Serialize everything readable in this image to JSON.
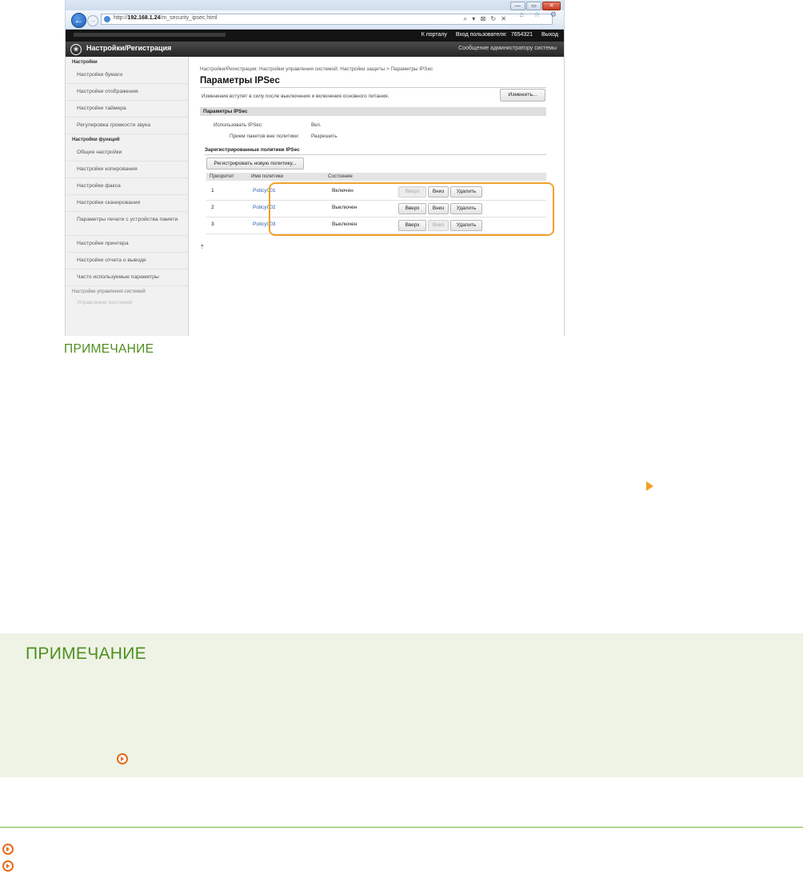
{
  "browser": {
    "url_prefix": "http://",
    "url_host": "192.168.1.24",
    "url_path": "/m_security_ipsec.html",
    "addr_controls": "⌕ ▾ ⊠ ↻ ✕",
    "home_icons": "⌂ ☆ ⚙",
    "window_buttons": [
      "—",
      "▭",
      "✕"
    ]
  },
  "topbar": {
    "portal_link": "К порталу",
    "login_label": "Вход пользователя:",
    "user_id": "7654321",
    "logout": "Выход"
  },
  "appbar": {
    "logo_icon": "❀",
    "title": "Настройки/Регистрация",
    "admin_message": "Сообщение администратору системы"
  },
  "sidebar": {
    "group1": "Настройки",
    "items1": [
      "Настройки бумаги",
      "Настройки отображения",
      "Настройки таймера",
      "Регулировка громкости звука"
    ],
    "group2": "Настройки функций",
    "items2": [
      "Общие настройки",
      "Настройки копирования",
      "Настройки факса",
      "Настройки сканирования"
    ],
    "item_print_memory": "Параметры печати с устройства памяти",
    "items3": [
      "Настройки принтера",
      "Настройки отчета о выводе",
      "Часто используемые параметры"
    ],
    "group3": "Настройки управления системой",
    "faded_item": "Управление системой"
  },
  "content": {
    "breadcrumb": "Настройки/Регистрация: Настройки управления системой: Настройки защиты > Параметры IPSec",
    "title": "Параметры IPSec",
    "notice": "Изменения вступят в силу после выключения и включения основного питания.",
    "edit_button": "Изменить...",
    "section_title": "Параметры IPSec",
    "use_ipsec_label": "Использовать IPSec:",
    "use_ipsec_value": "Вкл.",
    "packets_label": "Прием пакетов вне политики:",
    "packets_value": "Разрешить",
    "registered_title": "Зарегистрированные политики IPSec",
    "register_button": "Регистрировать новую политику...",
    "table_headers": [
      "Приоритет",
      "Имя политики",
      "Состояние"
    ],
    "rows": [
      {
        "priority": "1",
        "name": "Policy001",
        "state": "Включен"
      },
      {
        "priority": "2",
        "name": "Policy002",
        "state": "Выключен"
      },
      {
        "priority": "3",
        "name": "Policy003",
        "state": "Выключен"
      }
    ],
    "btn_up": "Вверх",
    "btn_down": "Вниз",
    "btn_delete": "Удалить",
    "top_marker": "⇡"
  },
  "doc": {
    "note_heading_1": "ПРИМЕЧАНИЕ",
    "note_heading_2": "ПРИМЕЧАНИЕ"
  },
  "colors": {
    "note_green": "#4e8f1e",
    "highlight_orange": "#f0a12a",
    "link_orange": "#e46a1b",
    "note_bg": "#eef3e6"
  }
}
